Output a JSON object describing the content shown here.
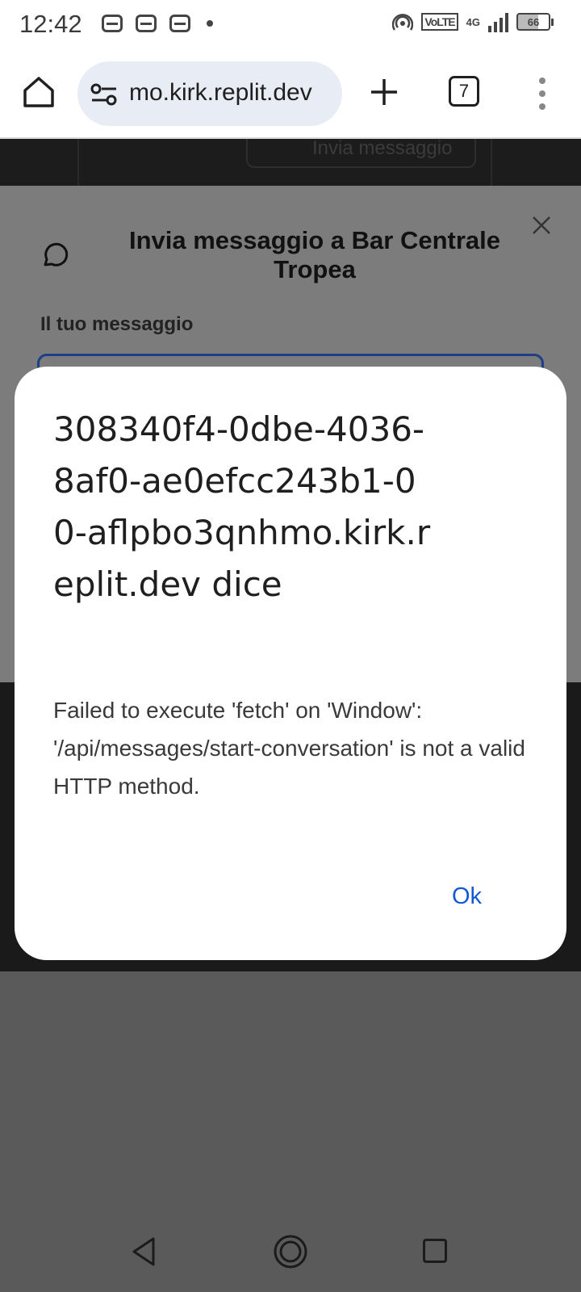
{
  "status_bar": {
    "time": "12:42",
    "volte": "VoLTE",
    "network": "4G",
    "battery": "66",
    "battery_level": 0.66,
    "notification_icons": [
      "wallet-icon",
      "wallet-icon",
      "wallet-icon",
      "dot-icon"
    ],
    "system_icons": [
      "hotspot-icon",
      "volte-icon",
      "signal-icon",
      "battery-icon"
    ]
  },
  "browser": {
    "url": "mo.kirk.replit.dev",
    "tab_count": "7"
  },
  "page": {
    "behind_button_label": "Invia messaggio",
    "modal": {
      "title": "Invia messaggio a Bar Centrale Tropea",
      "field_label": "Il tuo messaggio"
    }
  },
  "alert": {
    "title": "308340f4-0dbe-4036-8af0-ae0efcc243b1-00-aflpbo3qnhmo.kirk.replit.dev dice",
    "message": "Failed to execute 'fetch' on 'Window': '/api/messages/start-conversation' is not a valid HTTP method.",
    "ok_label": "Ok"
  },
  "colors": {
    "accent": "#1558d6",
    "scrim": "#5a5a5a",
    "input_border": "#1d3f86"
  }
}
